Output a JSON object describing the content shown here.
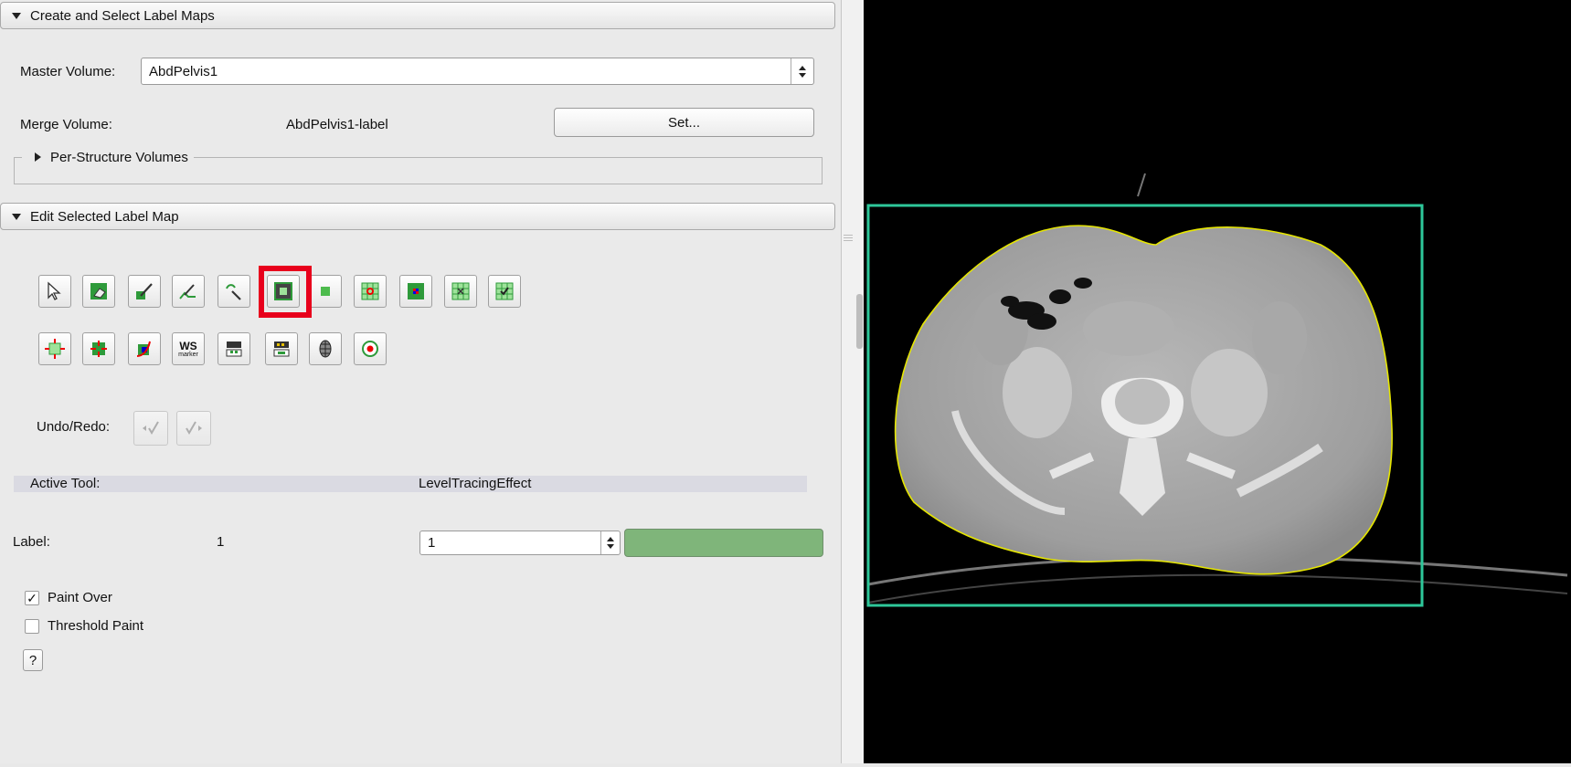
{
  "sections": {
    "create": {
      "title": "Create and Select Label Maps"
    },
    "edit": {
      "title": "Edit Selected Label Map"
    }
  },
  "master_volume": {
    "label": "Master Volume:",
    "value": "AbdPelvis1"
  },
  "merge_volume": {
    "label": "Merge Volume:",
    "value": "AbdPelvis1-label",
    "button": "Set..."
  },
  "per_structure": {
    "title": "Per-Structure Volumes"
  },
  "tools": {
    "selected": "LevelTracingEffect",
    "row1": [
      "default-tool",
      "erase-label",
      "paint-effect",
      "draw-effect",
      "level-tracing-effect",
      "image-eraser",
      "rectangle",
      "identify-islands",
      "change-island",
      "remove-islands",
      "save-island"
    ],
    "row2": [
      "dilate",
      "erode",
      "change-label",
      "watershed-marker",
      "grow-cut",
      "fast-marching",
      "model",
      "wand"
    ],
    "ws_text": "WS",
    "ws_subtext": "marker"
  },
  "undo_redo": {
    "label": "Undo/Redo:"
  },
  "active_tool": {
    "label": "Active Tool:",
    "value": "LevelTracingEffect"
  },
  "label": {
    "label": "Label:",
    "number": "1",
    "spin_value": "1",
    "color": "#7fb57a"
  },
  "options": {
    "paint_over": {
      "label": "Paint Over",
      "checked": true,
      "mark": "✓"
    },
    "threshold_paint": {
      "label": "Threshold Paint",
      "checked": false
    }
  },
  "help_button": {
    "label": "?"
  },
  "colors": {
    "viewer_frame": "#2ec79a",
    "outline": "#e6e600",
    "selection": "#e8001c"
  }
}
